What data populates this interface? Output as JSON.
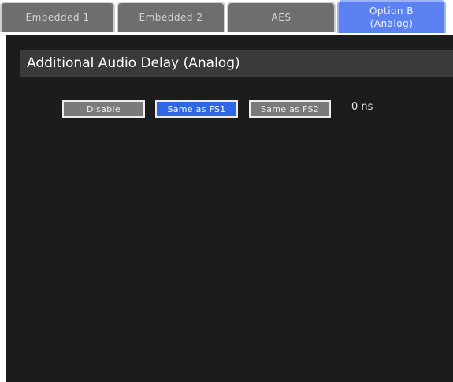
{
  "tabs": [
    {
      "label": "Embedded 1",
      "active": false
    },
    {
      "label": "Embedded 2",
      "active": false
    },
    {
      "label": "AES",
      "active": false
    },
    {
      "label_line1": "Option B",
      "label_line2": "(Analog)",
      "active": true
    }
  ],
  "section": {
    "title": "Additional Audio Delay (Analog)"
  },
  "delay_options": {
    "disable": "Disable",
    "same_fs1": "Same as FS1",
    "same_fs2": "Same as FS2",
    "selected": "Same as FS1"
  },
  "delay_value": "0 ns",
  "colors": {
    "panel_bg": "#1c1c1c",
    "tab_bg": "#6e6e6e",
    "tab_active_bg": "#5b82f0",
    "button_bg": "#7a7a7a",
    "button_selected_bg": "#2f66e6"
  }
}
